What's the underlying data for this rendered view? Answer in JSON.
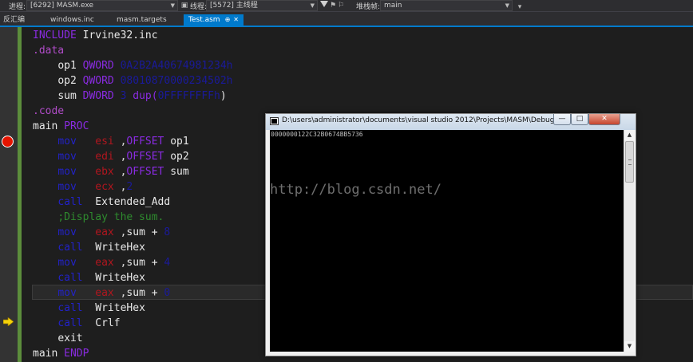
{
  "debug_toolbar": {
    "process_label": "进程:",
    "process_value": "[6292] MASM.exe",
    "lifecycle_label": "生命周期事件",
    "thread_label": "线程:",
    "thread_value": "[5572] 主线程",
    "stack_label": "堆栈帧:",
    "stack_value": "main"
  },
  "tabs": [
    {
      "label": "反汇编"
    },
    {
      "label": "windows.inc"
    },
    {
      "label": "masm.targets"
    },
    {
      "label": "Test.asm",
      "active": true,
      "pin": "⊕",
      "close": "✕"
    }
  ],
  "code": {
    "include_kw": "INCLUDE",
    "include_arg": "Irvine32.inc",
    "data_dir": ".data",
    "op1_name": "op1",
    "op1_type": "QWORD",
    "op1_value": "0A2B2A40674981234h",
    "op2_name": "op2",
    "op2_type": "QWORD",
    "op2_value": "08010870000234502h",
    "sum_name": "sum",
    "sum_type": "DWORD",
    "sum_count": "3",
    "sum_dup": "dup(",
    "sum_init": "0FFFFFFFFh",
    "sum_close": ")",
    "code_dir": ".code",
    "main_name": "main",
    "main_proc": "PROC",
    "l1_op": "mov",
    "l1_reg": "esi",
    "l1_off": "OFFSET",
    "l1_arg": "op1",
    "l2_op": "mov",
    "l2_reg": "edi",
    "l2_off": "OFFSET",
    "l2_arg": "op2",
    "l3_op": "mov",
    "l3_reg": "ebx",
    "l3_off": "OFFSET",
    "l3_arg": "sum",
    "l4_op": "mov",
    "l4_reg": "ecx",
    "l4_val": "2",
    "l5_op": "call",
    "l5_arg": "Extended_Add",
    "comment": ";Display the sum.",
    "l6_op": "mov",
    "l6_reg": "eax",
    "l6_arg": "sum +",
    "l6_val": "8",
    "l7_op": "call",
    "l7_arg": "WriteHex",
    "l8_op": "mov",
    "l8_reg": "eax",
    "l8_arg": "sum +",
    "l8_val": "4",
    "l9_op": "call",
    "l9_arg": "WriteHex",
    "l10_op": "mov",
    "l10_reg": "eax",
    "l10_arg": "sum +",
    "l10_val": "0",
    "l11_op": "call",
    "l11_arg": "WriteHex",
    "l12_op": "call",
    "l12_arg": "Crlf",
    "l13": "exit",
    "endp_name": "main",
    "endp_kw": "ENDP"
  },
  "console": {
    "title": "D:\\users\\administrator\\documents\\visual studio 2012\\Projects\\MASM\\Debug\\MASM.exe",
    "output": "0000000122C32B0674BB5736",
    "btn_min": "—",
    "btn_max": "□",
    "btn_close": "✕"
  },
  "watermark": "http://blog.csdn.net/",
  "colors": {
    "accent": "#007acc",
    "breakpoint": "#e51400",
    "change_bar": "#5c8d3c"
  }
}
